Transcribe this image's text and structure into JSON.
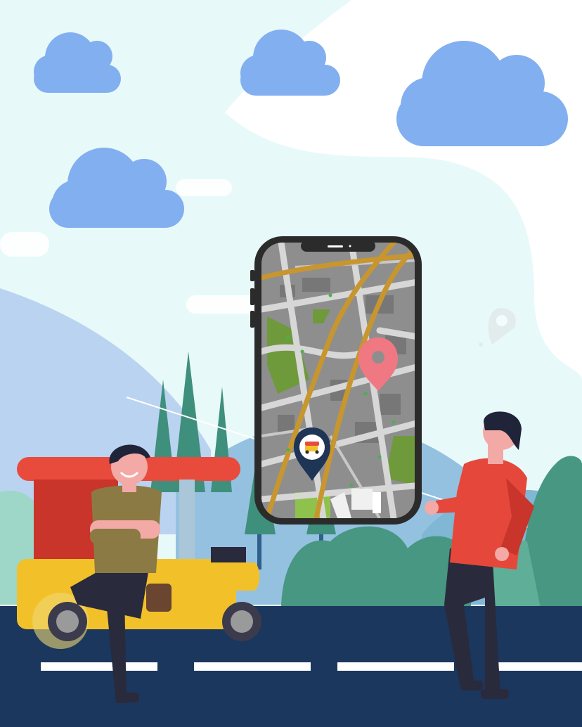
{
  "illustration": {
    "theme": "auto-rickshaw ride booking with map tracking",
    "colors": {
      "sky_tint": "#e8f9f9",
      "cloud": "#82aff0",
      "hill_back": "#b9d3f0",
      "hill_mid": "#95c1e0",
      "tree": "#3f8f7d",
      "bush": "#479783",
      "road": "#1b375d",
      "lane_marking": "#ffffff",
      "rickshaw_body": "#f2c12a",
      "rickshaw_roof": "#e84a3c",
      "map_ground": "#8e8e8e",
      "map_road": "#d7d7d7",
      "map_highway": "#c8962e",
      "map_park": "#6f9a3c",
      "pin_destination": "#f07882",
      "pin_driver": "#1f3556",
      "driver_shirt": "#8c7a44",
      "rider_shirt": "#e5483b",
      "pants": "#2a2a3d"
    },
    "icons": {
      "destination_marker": "map-pin-icon",
      "driver_marker": "rickshaw-location-pin-icon"
    }
  }
}
